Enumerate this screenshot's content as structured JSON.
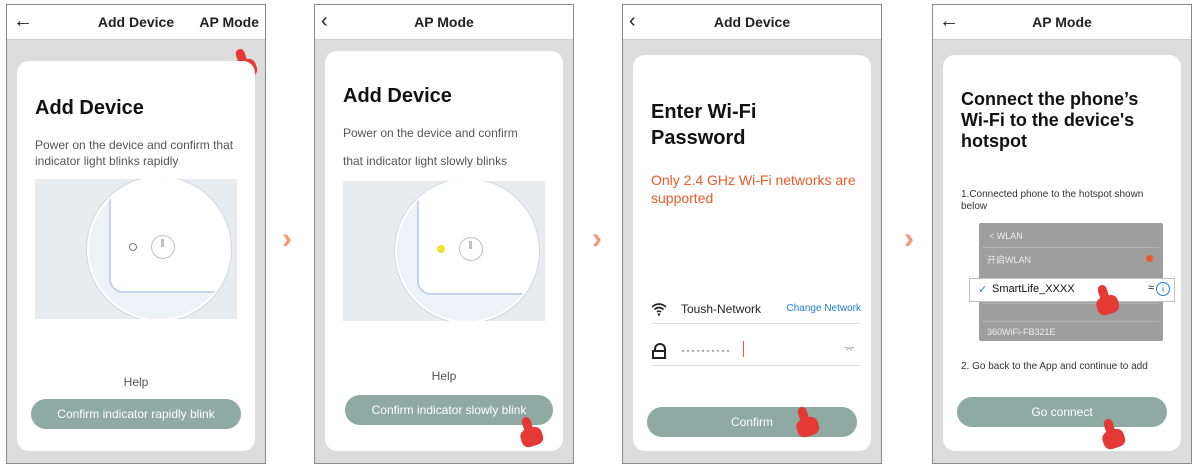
{
  "screens": [
    {
      "top_title": "Add Device",
      "top_right": "AP Mode",
      "heading": "Add Device",
      "body": "Power on the device and confirm that indicator light blinks rapidly",
      "help": "Help",
      "button": "Confirm indicator rapidly blink"
    },
    {
      "top_title": "AP Mode",
      "heading": "Add Device",
      "body_line1": "Power on the device and confirm",
      "body_line2": "that indicator light slowly blinks",
      "help": "Help",
      "button": "Confirm indicator slowly blink"
    },
    {
      "top_title": "Add Device",
      "heading_line1": "Enter Wi-Fi",
      "heading_line2": "Password",
      "warning": "Only 2.4 GHz Wi-Fi networks are supported",
      "network_name": "Toush-Network",
      "change_network": "Change Network",
      "password_mask": "··········",
      "button": "Confirm"
    },
    {
      "top_title": "AP Mode",
      "heading": "Connect the phone’s Wi-Fi to the device's hotspot",
      "step1": "1.Connected phone to the hotspot shown below",
      "wlan_title": "WLAN",
      "wlan_rows": [
        "开启WLAN",
        "",
        "",
        "360WiFi-FB321E"
      ],
      "hotspot_ssid": "SmartLife_XXXX",
      "step2": "2. Go back to the App and continue to add",
      "button": "Go connect"
    }
  ],
  "colors": {
    "accent_button": "#8fa9a3",
    "warning_text": "#ea5a2a",
    "link_blue": "#1e7bd8",
    "arrow": "#f4967a",
    "hand": "#e53935",
    "indicator_yellow": "#f2e32a"
  }
}
